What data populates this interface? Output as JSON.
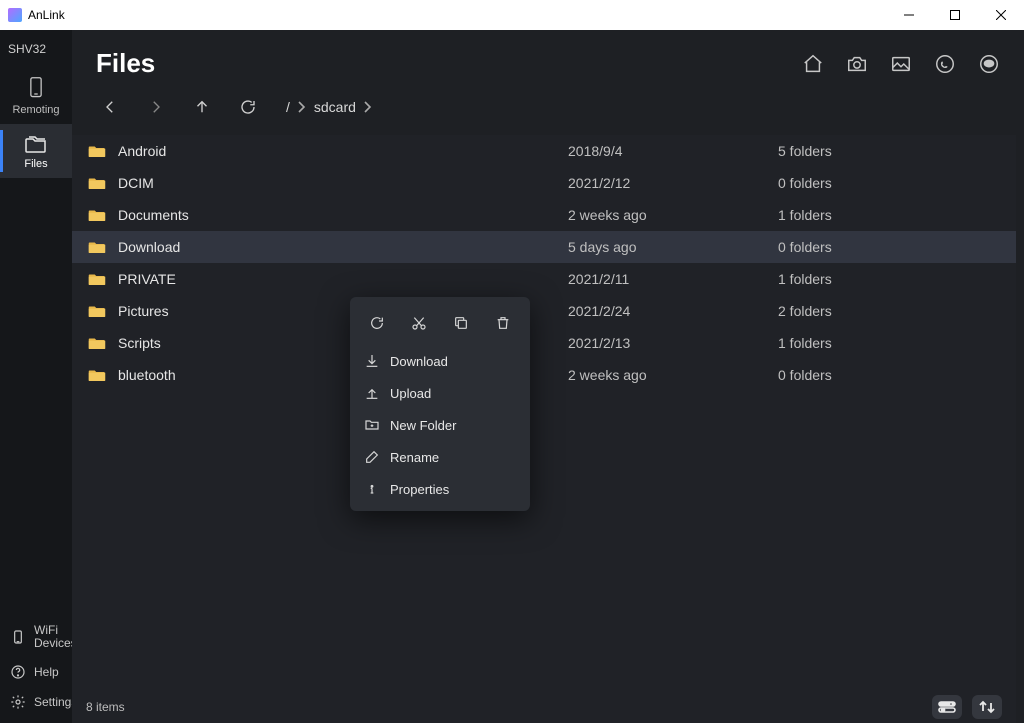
{
  "window": {
    "title": "AnLink"
  },
  "device": {
    "name": "SHV32"
  },
  "sidebar": {
    "items": [
      {
        "id": "remoting",
        "label": "Remoting"
      },
      {
        "id": "files",
        "label": "Files"
      }
    ],
    "bottom": [
      {
        "id": "wifi",
        "label": "WiFi Devices"
      },
      {
        "id": "help",
        "label": "Help"
      },
      {
        "id": "settings",
        "label": "Settings"
      }
    ]
  },
  "page": {
    "title": "Files"
  },
  "breadcrumb": {
    "root": "/",
    "segment": "sdcard"
  },
  "files": [
    {
      "name": "Android",
      "date": "2018/9/4",
      "folders": "5 folders"
    },
    {
      "name": "DCIM",
      "date": "2021/2/12",
      "folders": "0 folders"
    },
    {
      "name": "Documents",
      "date": "2 weeks ago",
      "folders": "1 folders"
    },
    {
      "name": "Download",
      "date": "5 days ago",
      "folders": "0 folders"
    },
    {
      "name": "PRIVATE",
      "date": "2021/2/11",
      "folders": "1 folders"
    },
    {
      "name": "Pictures",
      "date": "2021/2/24",
      "folders": "2 folders"
    },
    {
      "name": "Scripts",
      "date": "2021/2/13",
      "folders": "1 folders"
    },
    {
      "name": "bluetooth",
      "date": "2 weeks ago",
      "folders": "0 folders"
    }
  ],
  "selectedIndex": 3,
  "contextMenu": {
    "items": [
      {
        "id": "download",
        "label": "Download"
      },
      {
        "id": "upload",
        "label": "Upload"
      },
      {
        "id": "newfolder",
        "label": "New Folder"
      },
      {
        "id": "rename",
        "label": "Rename"
      },
      {
        "id": "properties",
        "label": "Properties"
      }
    ]
  },
  "status": {
    "itemCount": "8 items"
  }
}
